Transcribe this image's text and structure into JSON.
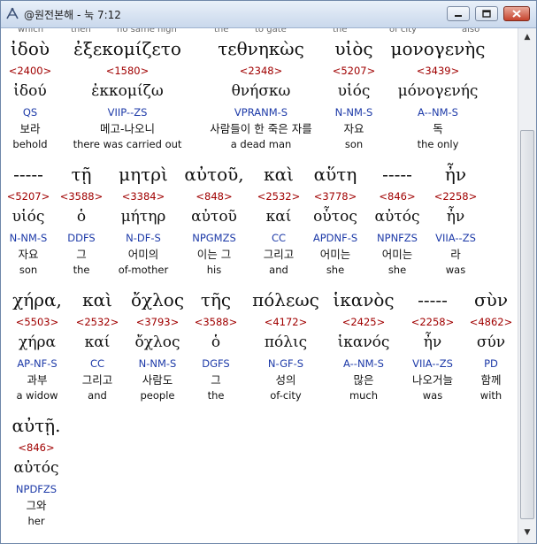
{
  "window": {
    "title": "@원전본해 - 눅 7:12"
  },
  "top_partial": [
    "which",
    "then",
    "no same high",
    "the",
    "to gate",
    "the",
    "of city",
    "also"
  ],
  "rows": [
    {
      "words": [
        {
          "gk": "ἰδοὺ",
          "num": "<2400>",
          "lemma": "ἰδού",
          "parse": "QS",
          "kor": "보라",
          "eng": "behold"
        },
        {
          "gk": "ἐξεκομίζετο",
          "num": "<1580>",
          "lemma": "ἐκκομίζω",
          "parse": "VIIP--ZS",
          "kor": "메고-나오니",
          "eng": "there was carried out"
        },
        {
          "gk": "τεθνηκὼς",
          "num": "<2348>",
          "lemma": "θνήσκω",
          "parse": "VPRANM-S",
          "kor": "사람들이 한 죽은 자를",
          "eng": "a dead man"
        },
        {
          "gk": "υἱὸς",
          "num": "<5207>",
          "lemma": "υἱός",
          "parse": "N-NM-S",
          "kor": "자요",
          "eng": "son"
        },
        {
          "gk": "μονογενὴς",
          "num": "<3439>",
          "lemma": "μόνογενής",
          "parse": "A--NM-S",
          "kor": "독",
          "eng": "the only"
        }
      ]
    },
    {
      "words": [
        {
          "gk": "-----",
          "num": "<5207>",
          "lemma": "υἱός",
          "parse": "N-NM-S",
          "kor": "자요",
          "eng": "son"
        },
        {
          "gk": "τῇ",
          "num": "<3588>",
          "lemma": "ὁ",
          "parse": "DDFS",
          "kor": "그",
          "eng": "the"
        },
        {
          "gk": "μητρὶ",
          "num": "<3384>",
          "lemma": "μήτηρ",
          "parse": "N-DF-S",
          "kor": "어미의",
          "eng": "of-mother"
        },
        {
          "gk": "αὐτοῦ,",
          "num": "<848>",
          "lemma": "αὐτοῦ",
          "parse": "NPGMZS",
          "kor": "이는 그",
          "eng": "his"
        },
        {
          "gk": "καὶ",
          "num": "<2532>",
          "lemma": "καί",
          "parse": "CC",
          "kor": "그리고",
          "eng": "and"
        },
        {
          "gk": "αὕτη",
          "num": "<3778>",
          "lemma": "οὗτος",
          "parse": "APDNF-S",
          "kor": "어미는",
          "eng": "she"
        },
        {
          "gk": "-----",
          "num": "<846>",
          "lemma": "αὐτός",
          "parse": "NPNFZS",
          "kor": "어미는",
          "eng": "she"
        },
        {
          "gk": "ἦν",
          "num": "<2258>",
          "lemma": "ἦν",
          "parse": "VIIA--ZS",
          "kor": "라",
          "eng": "was"
        }
      ]
    },
    {
      "words": [
        {
          "gk": "χήρα,",
          "num": "<5503>",
          "lemma": "χήρα",
          "parse": "AP-NF-S",
          "kor": "과부",
          "eng": "a widow"
        },
        {
          "gk": "καὶ",
          "num": "<2532>",
          "lemma": "καί",
          "parse": "CC",
          "kor": "그리고",
          "eng": "and"
        },
        {
          "gk": "ὄχλος",
          "num": "<3793>",
          "lemma": "ὄχλος",
          "parse": "N-NM-S",
          "kor": "사람도",
          "eng": "people"
        },
        {
          "gk": "τῆς",
          "num": "<3588>",
          "lemma": "ὁ",
          "parse": "DGFS",
          "kor": "그",
          "eng": "the"
        },
        {
          "gk": "πόλεως",
          "num": "<4172>",
          "lemma": "πόλις",
          "parse": "N-GF-S",
          "kor": "성의",
          "eng": "of-city"
        },
        {
          "gk": "ἱκανὸς",
          "num": "<2425>",
          "lemma": "ἱκανός",
          "parse": "A--NM-S",
          "kor": "많은",
          "eng": "much"
        },
        {
          "gk": "-----",
          "num": "<2258>",
          "lemma": "ἦν",
          "parse": "VIIA--ZS",
          "kor": "나오거늘",
          "eng": "was"
        },
        {
          "gk": "σὺν",
          "num": "<4862>",
          "lemma": "σύν",
          "parse": "PD",
          "kor": "함께",
          "eng": "with"
        }
      ]
    },
    {
      "words": [
        {
          "gk": "αὐτῇ.",
          "num": "<846>",
          "lemma": "αὐτός",
          "parse": "NPDFZS",
          "kor": "그와",
          "eng": "her"
        }
      ]
    }
  ]
}
